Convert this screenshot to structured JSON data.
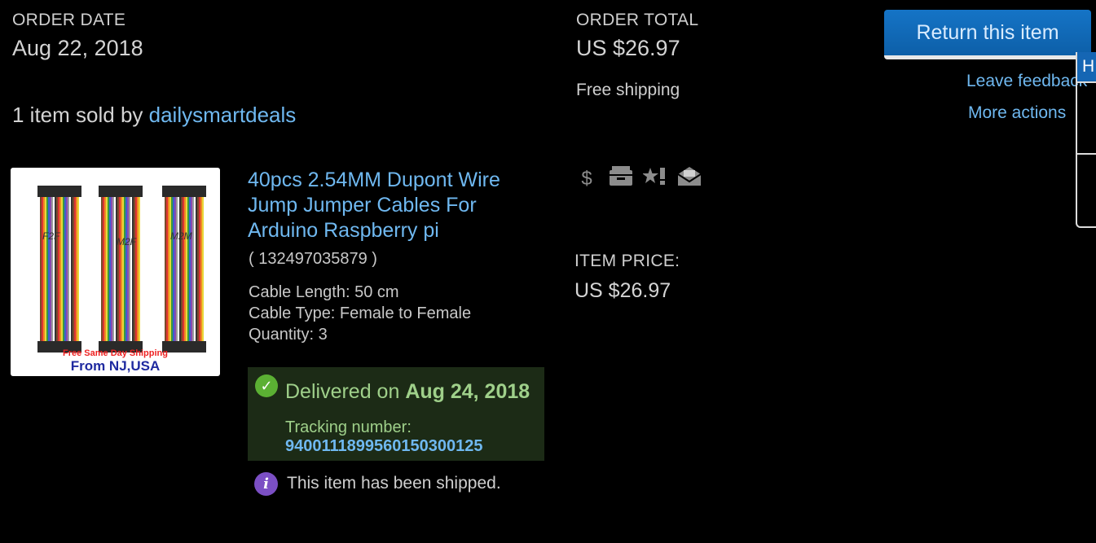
{
  "order": {
    "date_label": "ORDER DATE",
    "date_value": "Aug 22, 2018",
    "total_label": "ORDER TOTAL",
    "total_value": "US $26.97",
    "shipping": "Free shipping",
    "sold_by_prefix": "1 item sold by ",
    "seller": "dailysmartdeals"
  },
  "actions": {
    "return_label": "Return this item",
    "leave_feedback": "Leave feedback",
    "more_actions": "More actions",
    "popover_tab": "H"
  },
  "item": {
    "title": "40pcs 2.54MM Dupont Wire Jump Jumper Cables For Arduino Raspberry pi",
    "number": "( 132497035879 )",
    "specs": [
      "Cable Length: 50 cm",
      "Cable Type: Female to Female",
      "Quantity: 3"
    ],
    "image": {
      "tags": [
        "F2F",
        "M2F",
        "M2M"
      ],
      "promo": "Free Same Day Shipping",
      "origin": "From NJ,USA"
    },
    "price_label": "ITEM PRICE:",
    "price_value": "US $26.97"
  },
  "status_icons": [
    "dollar-icon",
    "package-icon",
    "feedback-star-icon",
    "envelope-icon"
  ],
  "delivery": {
    "prefix": "Delivered on ",
    "date": "Aug 24, 2018",
    "tracking_label": "Tracking number:",
    "tracking_number": "9400111899560150300125"
  },
  "shipped_message": "This item has been shipped.",
  "colors": {
    "link": "#6fb8f0",
    "button": "#1574c6",
    "delivered_bg": "#1c2b16",
    "delivered_text": "#9fd08a"
  }
}
